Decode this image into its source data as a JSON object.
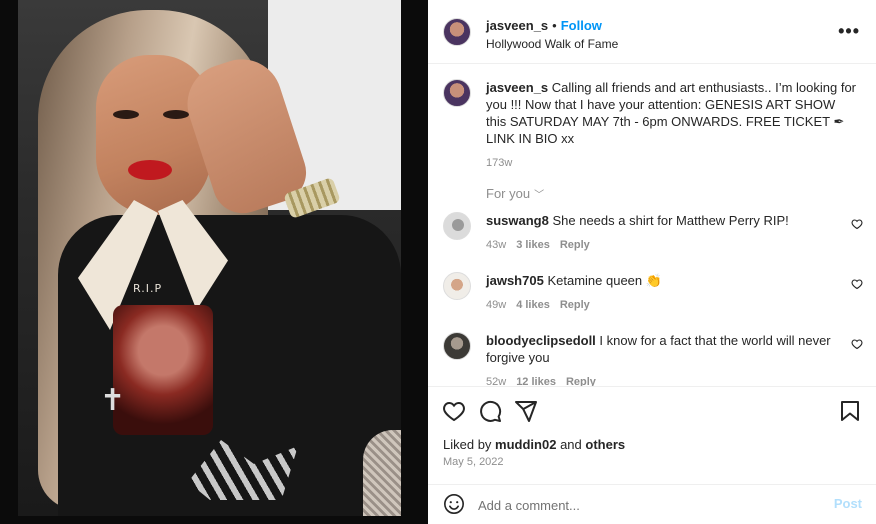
{
  "post": {
    "username": "jasveen_s",
    "dot": "•",
    "follow_label": "Follow",
    "location": "Hollywood Walk of Fame",
    "more_icon": "ellipsis-icon",
    "caption": "Calling all friends and art enthusiasts.. I’m looking for you !!! Now that I have your attention: GENESIS ART SHOW this SATURDAY MAY 7th - 6pm ONWARDS. FREE TICKET ✒ LINK IN BIO xx",
    "caption_time": "173w",
    "photo_print_text": "R.I.P"
  },
  "for_you": {
    "label": "For you",
    "icon": "chevron-down-icon"
  },
  "comments": [
    {
      "username": "suswang8",
      "text": "She needs a shirt for Matthew Perry RIP!",
      "time": "43w",
      "likes": "3 likes",
      "reply": "Reply"
    },
    {
      "username": "jawsh705",
      "text": "Ketamine queen 👏",
      "time": "49w",
      "likes": "4 likes",
      "reply": "Reply"
    },
    {
      "username": "bloodyeclipsedoll",
      "text": "I know for a fact that the world will never forgive you",
      "time": "52w",
      "likes": "12 likes",
      "reply": "Reply"
    }
  ],
  "actions": {
    "like_icon": "heart-icon",
    "comment_icon": "comment-icon",
    "share_icon": "share-icon",
    "save_icon": "bookmark-icon"
  },
  "likes": {
    "prefix": "Liked by ",
    "user": "muddin02",
    "middle": " and ",
    "others": "others"
  },
  "date": "May 5, 2022",
  "add_comment": {
    "placeholder": "Add a comment...",
    "post_label": "Post",
    "emoji_icon": "emoji-icon"
  },
  "colors": {
    "accent": "#0095f6",
    "post_disabled": "#b2dffc",
    "muted": "#8e8e8e",
    "text": "#262626"
  }
}
